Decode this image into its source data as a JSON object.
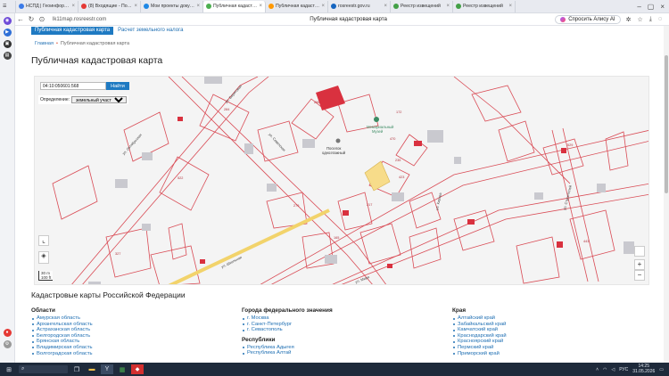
{
  "tabs": [
    {
      "label": "НСПД | Геоинформа...",
      "color": "#3b7be8"
    },
    {
      "label": "(8) Входящие - Почта",
      "color": "#e53935"
    },
    {
      "label": "Мои проекты докуме...",
      "color": "#1e88e5"
    },
    {
      "label": "Публичная кадастр...",
      "color": "#4caf50",
      "active": true
    },
    {
      "label": "Публичная кадастр...",
      "color": "#ff9800"
    },
    {
      "label": "rosreestr.gov.ru",
      "color": "#1565c0"
    },
    {
      "label": "Реестр извещений",
      "color": "#43a047"
    },
    {
      "label": "Реестр извещений",
      "color": "#43a047"
    }
  ],
  "address": {
    "url": "lk11map.rosreestr.com",
    "page_title": "Публичная кадастровая карта",
    "alisa": "Спросить Алису AI"
  },
  "subnav": {
    "active": "Публичная кадастровая карта",
    "other": "Расчет земельного налога"
  },
  "breadcrumbs": {
    "home": "Главная",
    "current": "Публичная кадастровая карта"
  },
  "page_heading": "Публичная кадастровая карта",
  "map": {
    "search_value": "04:10:050601:568",
    "search_button": "Найти",
    "definition_label": "Определение:",
    "definition_value": "земельный участок",
    "scale": {
      "m": "30 m",
      "ft": "100 ft"
    },
    "zoom_in": "+",
    "zoom_out": "−",
    "labels": {
      "l1": "Поселок",
      "l2": "одноэтажный",
      "l3": "Мемориальный",
      "l4": "Музей"
    },
    "streets": {
      "s1": "ул. Октябрьская",
      "s2": "ул. Советская",
      "s3": "ул. Школьная",
      "s4": "ул. Кирова",
      "s5": "ул. Мира",
      "s6": "ул. Строителей",
      "s7": "ул. Береговая"
    },
    "parcels": {
      "p1": "284",
      "p2": "286",
      "p3": "172",
      "p4": "522",
      "p5": "470",
      "p6": "235",
      "p7": "423",
      "p8": "279",
      "p9": "217",
      "p10": "327",
      "p11": "165",
      "p12": "443",
      "p13": "529"
    }
  },
  "federal": {
    "title": "Кадастровые карты Российской Федерации",
    "oblasti": {
      "heading": "Области",
      "items": [
        "Амурская область",
        "Архангельская область",
        "Астраханская область",
        "Белгородская область",
        "Брянская область",
        "Владимирская область",
        "Волгоградская область"
      ]
    },
    "cities": {
      "heading": "Города федерального значения",
      "items": [
        "г. Москва",
        "г. Санкт-Петербург",
        "г. Севастополь"
      ]
    },
    "republics": {
      "heading": "Республики",
      "items": [
        "Республика Адыгея",
        "Республика Алтай"
      ]
    },
    "kraya": {
      "heading": "Края",
      "items": [
        "Алтайский край",
        "Забайкальский край",
        "Камчатский край",
        "Краснодарский край",
        "Красноярский край",
        "Пермский край",
        "Приморский край"
      ]
    }
  },
  "taskbar": {
    "lang": "РУС",
    "time": "14:25",
    "date": "31.05.2026"
  }
}
